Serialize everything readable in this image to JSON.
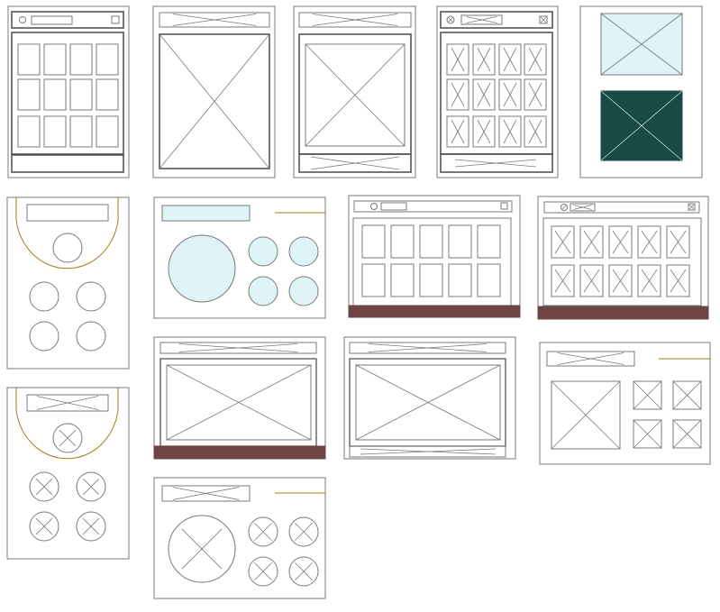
{
  "colors": {
    "background": "#ffffff",
    "stroke": "#7a7a7a",
    "stroke_dark": "#555555",
    "light_cyan": "#dff4f7",
    "dark_teal": "#1a4a44",
    "maroon": "#6f4444",
    "gold": "#a77a1a"
  },
  "wireframes": [
    {
      "name": "phone-wireframe-tile-grid",
      "kind": "phone",
      "variant": "tile-grid"
    },
    {
      "name": "phone-wireframe-single-image",
      "kind": "phone",
      "variant": "single-image"
    },
    {
      "name": "phone-wireframe-single-image-crossed-bars",
      "kind": "phone",
      "variant": "single-image-crossed"
    },
    {
      "name": "phone-wireframe-image-grid",
      "kind": "phone",
      "variant": "image-grid"
    },
    {
      "name": "color-swatch-card",
      "kind": "swatch",
      "variant": "light-and-dark"
    },
    {
      "name": "watch-wireframe-circles",
      "kind": "watch",
      "variant": "plain"
    },
    {
      "name": "landscape-wireframe-circles",
      "kind": "landscape-circles",
      "variant": "filled"
    },
    {
      "name": "tablet-wireframe-tile-grid",
      "kind": "tablet",
      "variant": "tile-grid"
    },
    {
      "name": "tablet-wireframe-image-grid",
      "kind": "tablet",
      "variant": "image-grid"
    },
    {
      "name": "watch-wireframe-image-circles",
      "kind": "watch",
      "variant": "crossed"
    },
    {
      "name": "landscape-wireframe-single-image-footer",
      "kind": "landscape-single",
      "variant": "footer"
    },
    {
      "name": "landscape-wireframe-single-image-crossed-bars",
      "kind": "landscape-single",
      "variant": "crossed"
    },
    {
      "name": "landscape-wireframe-image-thumbnails",
      "kind": "landscape-thumbs",
      "variant": "crossed"
    },
    {
      "name": "landscape-wireframe-image-circles",
      "kind": "landscape-circles",
      "variant": "crossed"
    }
  ]
}
